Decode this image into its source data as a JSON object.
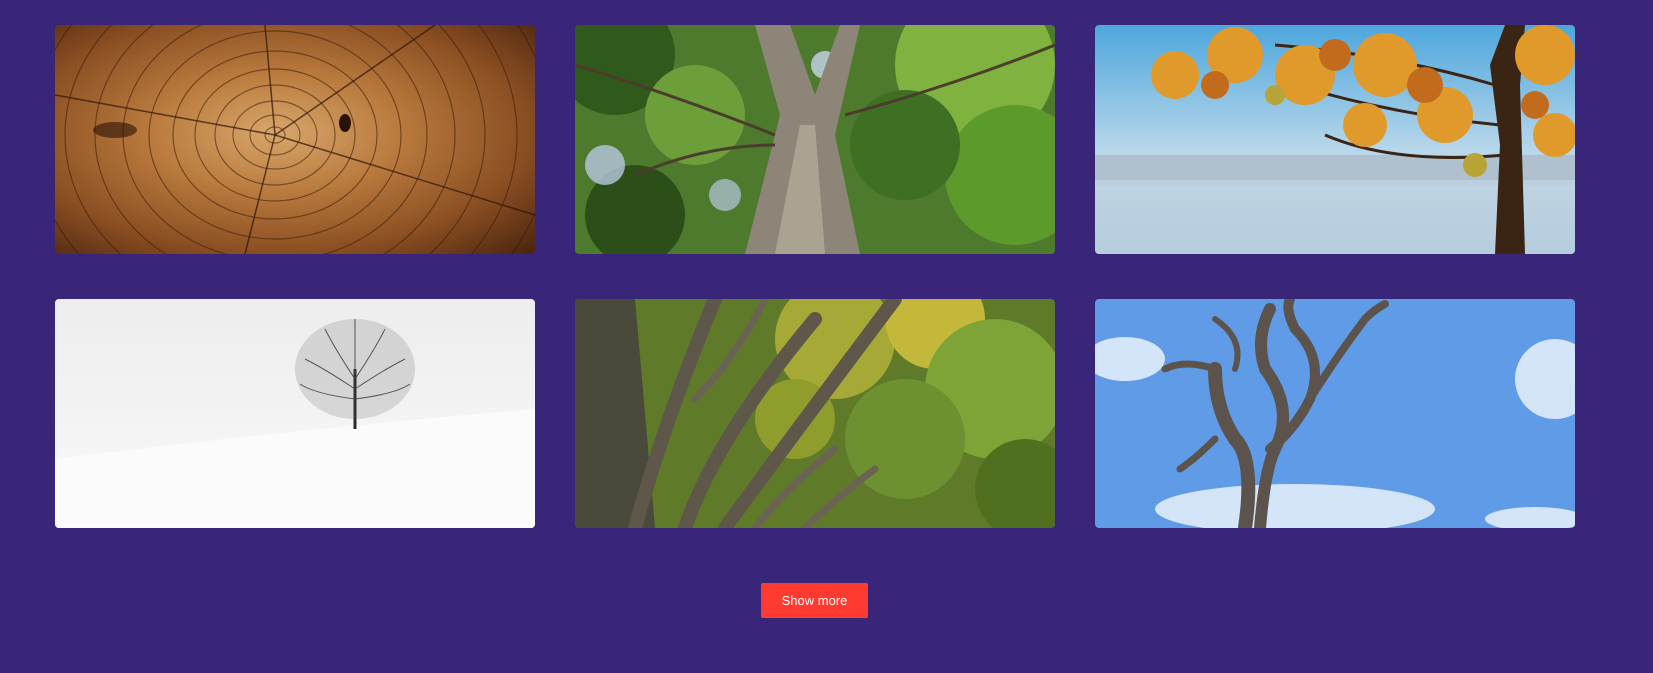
{
  "gallery": {
    "images": [
      {
        "name": "tree-rings-photo"
      },
      {
        "name": "tree-trunk-looking-up-photo"
      },
      {
        "name": "autumn-tree-by-lake-photo"
      },
      {
        "name": "lone-tree-in-snow-photo"
      },
      {
        "name": "beech-tree-canopy-photo"
      },
      {
        "name": "twisted-dead-tree-sky-photo"
      }
    ]
  },
  "actions": {
    "show_more_label": "Show more"
  },
  "colors": {
    "background": "#3a2679",
    "button": "#ff3b2f",
    "button_text": "#ffffff"
  }
}
